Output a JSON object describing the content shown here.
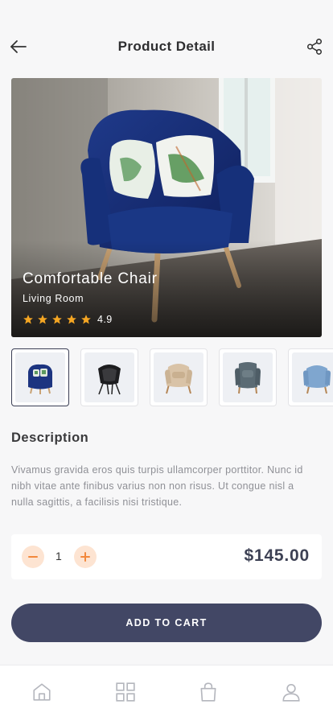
{
  "header": {
    "title": "Product Detail",
    "back_icon": "arrow-left-icon",
    "share_icon": "share-icon"
  },
  "product": {
    "name": "Comfortable Chair",
    "category": "Living Room",
    "rating": "4.9",
    "stars": 5,
    "description": "Vivamus gravida eros quis turpis ullamcorper porttitor. Nunc id nibh vitae ante finibus varius non non risus. Ut congue nisl a nulla sagittis, a facilisis nisi tristique.",
    "price": "$145.00"
  },
  "gallery": {
    "selected_index": 0,
    "thumbnails": [
      "navy-armchair",
      "black-shell-chair",
      "beige-wingback-chair",
      "grey-wingback-chair",
      "light-blue-armchair"
    ]
  },
  "sections": {
    "description_title": "Description"
  },
  "quantity": {
    "value": "1",
    "minus_icon": "minus-icon",
    "plus_icon": "plus-icon"
  },
  "cart": {
    "button_label": "ADD TO CART"
  },
  "tabbar": {
    "items": [
      "home-icon",
      "grid-icon",
      "shopping-bag-icon",
      "user-icon"
    ]
  },
  "colors": {
    "accent": "#f5a623",
    "primary": "#424765",
    "stepper_bg": "#fde4d2",
    "price": "#3d4154"
  }
}
